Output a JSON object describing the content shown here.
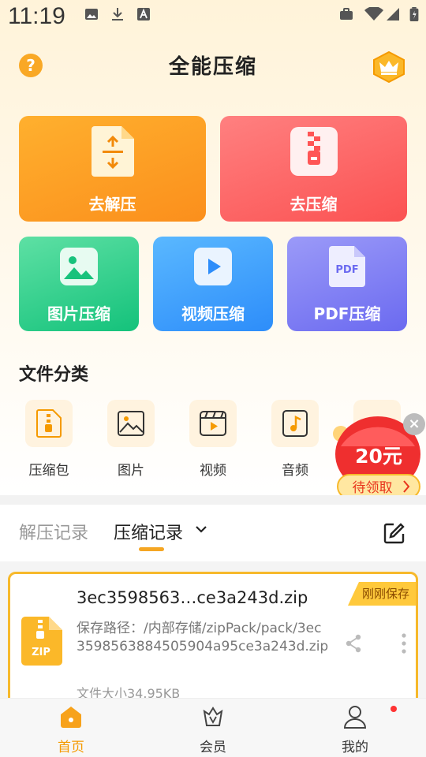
{
  "status_bar": {
    "time": "11:19"
  },
  "header": {
    "title": "全能压缩"
  },
  "tools": {
    "unzip": "去解压",
    "zip": "去压缩",
    "image": "图片压缩",
    "video": "视频压缩",
    "pdf": "PDF压缩",
    "pdf_icon_text": "PDF"
  },
  "categories": {
    "title": "文件分类",
    "items": [
      {
        "label": "压缩包",
        "icon": "archive-icon"
      },
      {
        "label": "图片",
        "icon": "image-icon"
      },
      {
        "label": "视频",
        "icon": "video-icon"
      },
      {
        "label": "音频",
        "icon": "audio-icon"
      }
    ]
  },
  "promo": {
    "amount": "20元",
    "cta": "待领取"
  },
  "records": {
    "tabs": [
      "解压记录",
      "压缩记录"
    ],
    "active_tab": "压缩记录",
    "item": {
      "badge": "刚刚保存",
      "name": "3ec3598563…ce3a243d.zip",
      "path": "保存路径：/内部存储/zipPack/pack/3ec3598563884505904a95ce3a243d.zip",
      "size": "文件大小34.95KB",
      "icon_text": "ZIP"
    }
  },
  "bottom_nav": [
    {
      "label": "首页",
      "active": true
    },
    {
      "label": "会员",
      "active": false
    },
    {
      "label": "我的",
      "active": false
    }
  ],
  "colors": {
    "accent": "#f5a623",
    "active_nav": "#f59a00"
  }
}
